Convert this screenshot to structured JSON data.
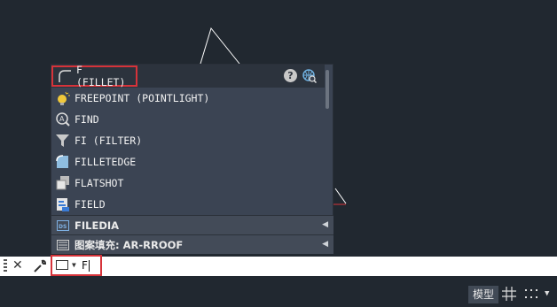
{
  "autocomplete": {
    "items": [
      {
        "label": "F (FILLET)",
        "icon": "fillet-icon"
      },
      {
        "label": "FREEPOINT (POINTLIGHT)",
        "icon": "pointlight-icon"
      },
      {
        "label": "FIND",
        "icon": "find-icon"
      },
      {
        "label": "FI (FILTER)",
        "icon": "filter-icon"
      },
      {
        "label": "FILLETEDGE",
        "icon": "filletedge-icon"
      },
      {
        "label": "FLATSHOT",
        "icon": "flatshot-icon"
      },
      {
        "label": "FIELD",
        "icon": "field-icon"
      }
    ],
    "categories": [
      {
        "label": "FILEDIA",
        "icon": "sysvar-icon"
      },
      {
        "label": "图案填充: AR-RROOF",
        "icon": "hatch-icon"
      }
    ],
    "help_label": "?"
  },
  "command_line": {
    "input_value": "F"
  },
  "status_bar": {
    "model_label": "模型"
  },
  "colors": {
    "highlight": "#d6333a",
    "popup_bg": "#3b4453",
    "canvas_bg": "#212830"
  }
}
